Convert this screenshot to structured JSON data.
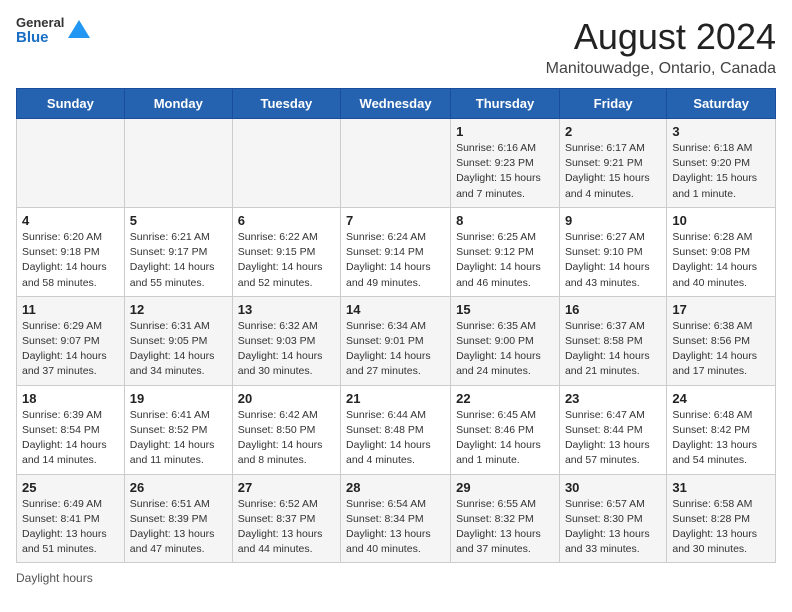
{
  "logo": {
    "line1": "General",
    "line2": "Blue"
  },
  "title": "August 2024",
  "location": "Manitouwadge, Ontario, Canada",
  "days_of_week": [
    "Sunday",
    "Monday",
    "Tuesday",
    "Wednesday",
    "Thursday",
    "Friday",
    "Saturday"
  ],
  "weeks": [
    [
      {
        "day": "",
        "info": ""
      },
      {
        "day": "",
        "info": ""
      },
      {
        "day": "",
        "info": ""
      },
      {
        "day": "",
        "info": ""
      },
      {
        "day": "1",
        "info": "Sunrise: 6:16 AM\nSunset: 9:23 PM\nDaylight: 15 hours\nand 7 minutes."
      },
      {
        "day": "2",
        "info": "Sunrise: 6:17 AM\nSunset: 9:21 PM\nDaylight: 15 hours\nand 4 minutes."
      },
      {
        "day": "3",
        "info": "Sunrise: 6:18 AM\nSunset: 9:20 PM\nDaylight: 15 hours\nand 1 minute."
      }
    ],
    [
      {
        "day": "4",
        "info": "Sunrise: 6:20 AM\nSunset: 9:18 PM\nDaylight: 14 hours\nand 58 minutes."
      },
      {
        "day": "5",
        "info": "Sunrise: 6:21 AM\nSunset: 9:17 PM\nDaylight: 14 hours\nand 55 minutes."
      },
      {
        "day": "6",
        "info": "Sunrise: 6:22 AM\nSunset: 9:15 PM\nDaylight: 14 hours\nand 52 minutes."
      },
      {
        "day": "7",
        "info": "Sunrise: 6:24 AM\nSunset: 9:14 PM\nDaylight: 14 hours\nand 49 minutes."
      },
      {
        "day": "8",
        "info": "Sunrise: 6:25 AM\nSunset: 9:12 PM\nDaylight: 14 hours\nand 46 minutes."
      },
      {
        "day": "9",
        "info": "Sunrise: 6:27 AM\nSunset: 9:10 PM\nDaylight: 14 hours\nand 43 minutes."
      },
      {
        "day": "10",
        "info": "Sunrise: 6:28 AM\nSunset: 9:08 PM\nDaylight: 14 hours\nand 40 minutes."
      }
    ],
    [
      {
        "day": "11",
        "info": "Sunrise: 6:29 AM\nSunset: 9:07 PM\nDaylight: 14 hours\nand 37 minutes."
      },
      {
        "day": "12",
        "info": "Sunrise: 6:31 AM\nSunset: 9:05 PM\nDaylight: 14 hours\nand 34 minutes."
      },
      {
        "day": "13",
        "info": "Sunrise: 6:32 AM\nSunset: 9:03 PM\nDaylight: 14 hours\nand 30 minutes."
      },
      {
        "day": "14",
        "info": "Sunrise: 6:34 AM\nSunset: 9:01 PM\nDaylight: 14 hours\nand 27 minutes."
      },
      {
        "day": "15",
        "info": "Sunrise: 6:35 AM\nSunset: 9:00 PM\nDaylight: 14 hours\nand 24 minutes."
      },
      {
        "day": "16",
        "info": "Sunrise: 6:37 AM\nSunset: 8:58 PM\nDaylight: 14 hours\nand 21 minutes."
      },
      {
        "day": "17",
        "info": "Sunrise: 6:38 AM\nSunset: 8:56 PM\nDaylight: 14 hours\nand 17 minutes."
      }
    ],
    [
      {
        "day": "18",
        "info": "Sunrise: 6:39 AM\nSunset: 8:54 PM\nDaylight: 14 hours\nand 14 minutes."
      },
      {
        "day": "19",
        "info": "Sunrise: 6:41 AM\nSunset: 8:52 PM\nDaylight: 14 hours\nand 11 minutes."
      },
      {
        "day": "20",
        "info": "Sunrise: 6:42 AM\nSunset: 8:50 PM\nDaylight: 14 hours\nand 8 minutes."
      },
      {
        "day": "21",
        "info": "Sunrise: 6:44 AM\nSunset: 8:48 PM\nDaylight: 14 hours\nand 4 minutes."
      },
      {
        "day": "22",
        "info": "Sunrise: 6:45 AM\nSunset: 8:46 PM\nDaylight: 14 hours\nand 1 minute."
      },
      {
        "day": "23",
        "info": "Sunrise: 6:47 AM\nSunset: 8:44 PM\nDaylight: 13 hours\nand 57 minutes."
      },
      {
        "day": "24",
        "info": "Sunrise: 6:48 AM\nSunset: 8:42 PM\nDaylight: 13 hours\nand 54 minutes."
      }
    ],
    [
      {
        "day": "25",
        "info": "Sunrise: 6:49 AM\nSunset: 8:41 PM\nDaylight: 13 hours\nand 51 minutes."
      },
      {
        "day": "26",
        "info": "Sunrise: 6:51 AM\nSunset: 8:39 PM\nDaylight: 13 hours\nand 47 minutes."
      },
      {
        "day": "27",
        "info": "Sunrise: 6:52 AM\nSunset: 8:37 PM\nDaylight: 13 hours\nand 44 minutes."
      },
      {
        "day": "28",
        "info": "Sunrise: 6:54 AM\nSunset: 8:34 PM\nDaylight: 13 hours\nand 40 minutes."
      },
      {
        "day": "29",
        "info": "Sunrise: 6:55 AM\nSunset: 8:32 PM\nDaylight: 13 hours\nand 37 minutes."
      },
      {
        "day": "30",
        "info": "Sunrise: 6:57 AM\nSunset: 8:30 PM\nDaylight: 13 hours\nand 33 minutes."
      },
      {
        "day": "31",
        "info": "Sunrise: 6:58 AM\nSunset: 8:28 PM\nDaylight: 13 hours\nand 30 minutes."
      }
    ]
  ],
  "footer": {
    "daylight_label": "Daylight hours"
  }
}
